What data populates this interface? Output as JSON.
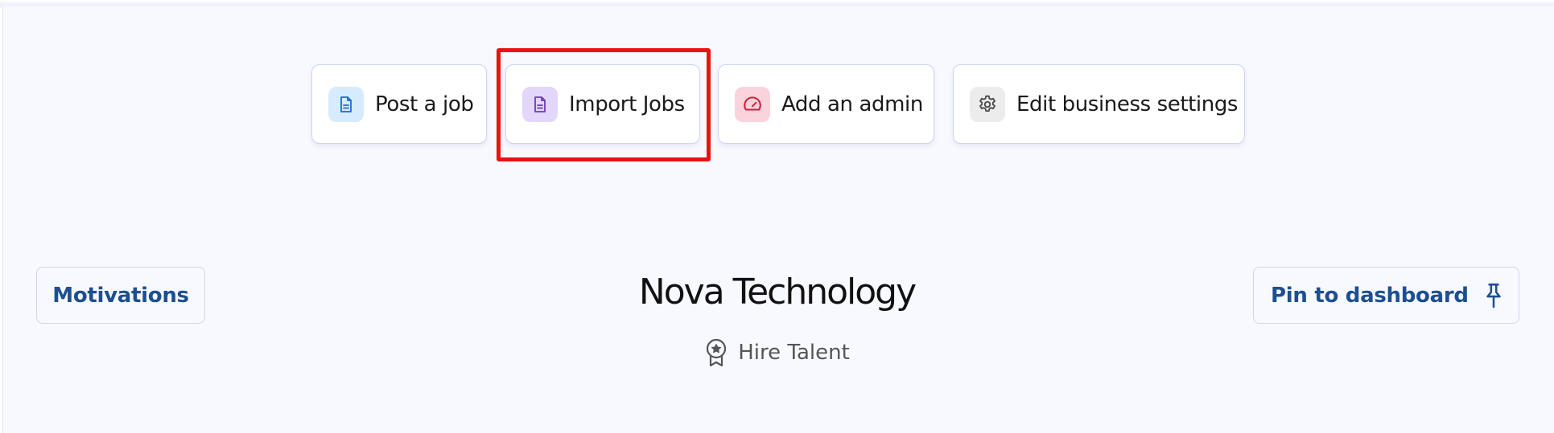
{
  "quick_actions": [
    {
      "label": "Post a job",
      "icon": "document-icon",
      "icon_bg": "#d6ebfd",
      "icon_color": "#1b6fc4"
    },
    {
      "label": "Import Jobs",
      "icon": "document-icon",
      "icon_bg": "#e3d6fb",
      "icon_color": "#6b3bc0"
    },
    {
      "label": "Add an admin",
      "icon": "speedometer-icon",
      "icon_bg": "#fbd3dc",
      "icon_color": "#c8243f"
    },
    {
      "label": "Edit business settings",
      "icon": "gear-icon",
      "icon_bg": "#ececec",
      "icon_color": "#4a4a4a"
    }
  ],
  "highlighted_action": "Import Jobs",
  "highlight_color": "#ea1111",
  "motivations_button": {
    "label": "Motivations"
  },
  "pin_button": {
    "label": "Pin to dashboard",
    "icon": "pin-icon"
  },
  "company": {
    "name": "Nova Technology",
    "tagline": "Hire Talent",
    "tagline_icon": "award-badge-icon"
  },
  "colors": {
    "link_blue": "#1d4f91",
    "card_border": "#cfd4f3",
    "background": "#f8f9fe"
  }
}
